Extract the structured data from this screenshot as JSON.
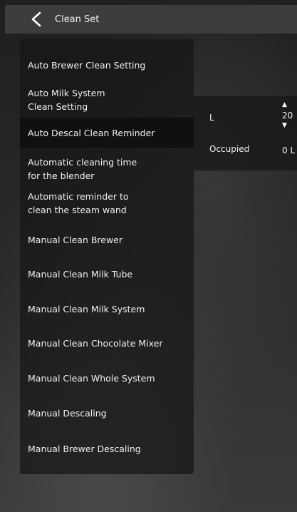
{
  "header": {
    "title": "Clean Set",
    "back_icon": "chevron-left-icon"
  },
  "menu": {
    "items": [
      {
        "lines": [
          "Auto Brewer Clean Setting"
        ],
        "selected": false
      },
      {
        "lines": [
          "Auto Milk System",
          "Clean Setting"
        ],
        "selected": false
      },
      {
        "lines": [
          "Auto Descal Clean Reminder"
        ],
        "selected": true
      },
      {
        "lines": [
          "Automatic cleaning time",
          "for the blender"
        ],
        "selected": false
      },
      {
        "lines": [
          "Automatic reminder to",
          "clean the steam wand"
        ],
        "selected": false
      },
      {
        "lines": [
          "Manual Clean Brewer"
        ],
        "selected": false
      },
      {
        "lines": [
          "Manual Clean Milk Tube"
        ],
        "selected": false
      },
      {
        "lines": [
          "Manual Clean Milk System"
        ],
        "selected": false
      },
      {
        "lines": [
          "Manual Clean Chocolate Mixer"
        ],
        "selected": false
      },
      {
        "lines": [
          "Manual Clean Whole System"
        ],
        "selected": false
      },
      {
        "lines": [
          "Manual Descaling"
        ],
        "selected": false
      },
      {
        "lines": [
          "Manual Brewer Descaling"
        ],
        "selected": false
      }
    ]
  },
  "panel": {
    "row1": {
      "label": "L",
      "value": "20",
      "up_icon": "triangle-up-icon",
      "down_icon": "triangle-down-icon"
    },
    "row2": {
      "label": "Occupied",
      "value": "0 L"
    }
  },
  "colors": {
    "header_bg": "#3d3d3d",
    "menu_bg": "#161616",
    "selected_bg": "#101010",
    "text": "#f0f0f0"
  }
}
